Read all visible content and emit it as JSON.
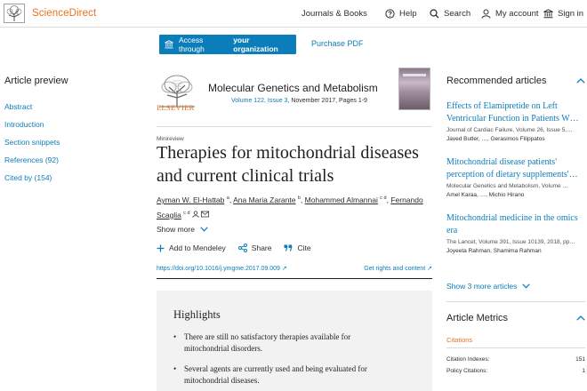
{
  "header": {
    "brand": "ScienceDirect",
    "nav": {
      "journals": "Journals & Books",
      "help": "Help",
      "search": "Search",
      "account": "My account",
      "signin": "Sign in"
    }
  },
  "access": {
    "button_prefix": "Access through",
    "button_bold": "your organization",
    "purchase": "Purchase PDF"
  },
  "sidebar": {
    "title": "Article preview",
    "items": [
      {
        "label": "Abstract"
      },
      {
        "label": "Introduction"
      },
      {
        "label": "Section snippets"
      },
      {
        "label": "References (92)"
      },
      {
        "label": "Cited by (154)"
      }
    ]
  },
  "journal": {
    "publisher": "ELSEVIER",
    "title": "Molecular Genetics and Metabolism",
    "volume": "Volume 122, Issue 3",
    "date_pages": ", November 2017, Pages 1-9"
  },
  "article": {
    "type": "Minireview",
    "title": "Therapies for mitochondrial diseases and current clinical trials",
    "authors": [
      {
        "name": "Ayman W. El-Hattab",
        "sup": "a"
      },
      {
        "name": "Ana Maria Zarante",
        "sup": "b"
      },
      {
        "name": "Mohammed Almannai",
        "sup": "c d"
      },
      {
        "name": "Fernando Scaglia",
        "sup": "c d"
      }
    ],
    "show_more": "Show more",
    "actions": {
      "mendeley": "Add to Mendeley",
      "share": "Share",
      "cite": "Cite"
    },
    "doi": "https://doi.org/10.1016/j.ymgme.2017.09.009",
    "rights": "Get rights and content"
  },
  "highlights": {
    "title": "Highlights",
    "items": [
      "There are still no satisfactory therapies available for mitochondrial disorders.",
      "Several agents are currently used and being evaluated for mitochondrial diseases."
    ]
  },
  "recommended": {
    "title": "Recommended articles",
    "articles": [
      {
        "title": "Effects of Elamipretide on Left Ventricular Function in Patients W…",
        "meta": "Journal of Cardiac Failure, Volume 26, Issue 5,…",
        "authors": "Javed Butler, …, Gerasimos Filippatos"
      },
      {
        "title": "Mitochondrial disease patients' perception of dietary supplements'…",
        "meta": "Molecular Genetics and Metabolism, Volume …",
        "authors": "Amel Karaa, …, Michio Hirano"
      },
      {
        "title": "Mitochondrial medicine in the omics era",
        "meta": "The Lancet, Volume 391, Issue 10139, 2018, pp…",
        "authors": "Joyeeta Rahman, Shamima Rahman"
      }
    ],
    "show_more": "Show 3 more articles"
  },
  "metrics": {
    "title": "Article Metrics",
    "citations_label": "Citations",
    "rows": [
      {
        "label": "Citation Indexes:",
        "value": "151"
      },
      {
        "label": "Policy Citations:",
        "value": "1"
      }
    ]
  },
  "colors": {
    "brand_orange": "#e9711c",
    "link_blue": "#0c7dbb",
    "highlight_bg": "#f2f2f2"
  }
}
